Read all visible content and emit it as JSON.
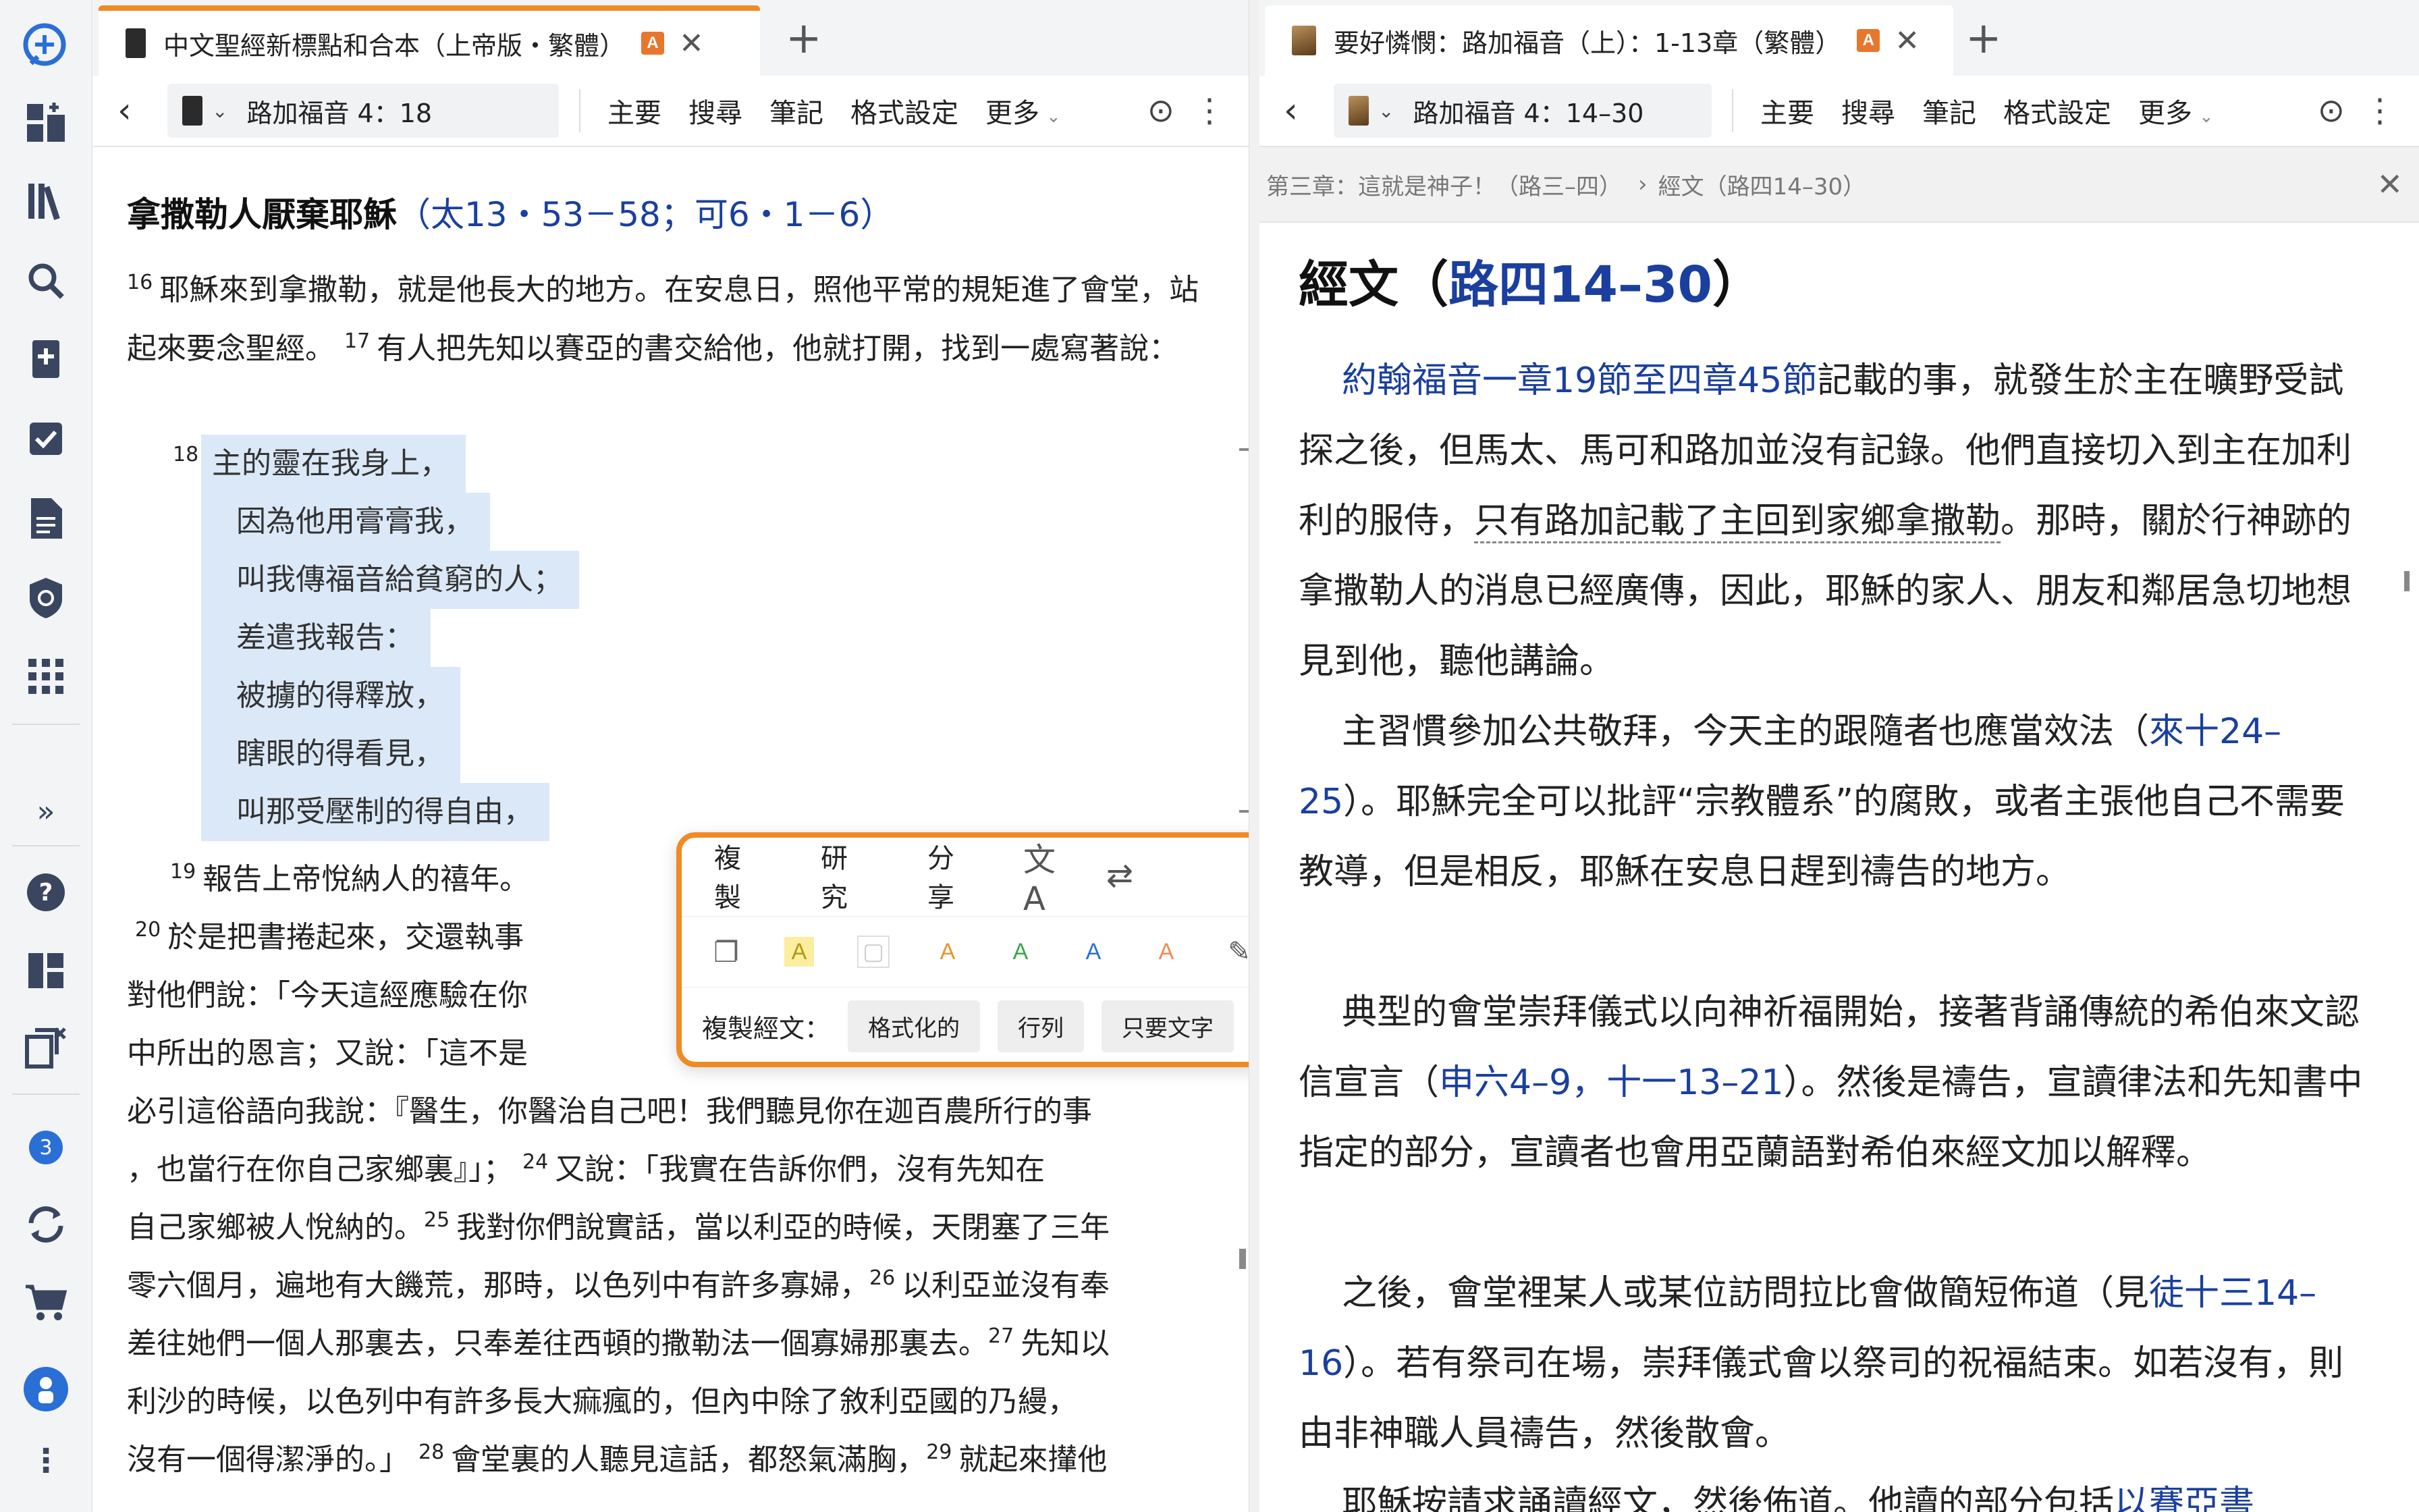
{
  "rail": {
    "items": [
      "logo-icon",
      "dashboard-add-icon",
      "library-icon",
      "search-icon",
      "bible-add-icon",
      "checklist-icon",
      "document-icon",
      "shield-icon",
      "apps-grid-icon"
    ],
    "expand": "»",
    "bottom": [
      "help-icon",
      "layout-icon",
      "copy-close-icon"
    ],
    "badge": "3",
    "bottom2": [
      "sync-icon",
      "cart-icon",
      "profile-icon",
      "more-icon"
    ]
  },
  "left": {
    "tab_title": "中文聖經新標點和合本（上帝版・繁體）",
    "tab_badge": "A",
    "ref": "路加福音 4：18",
    "toolbar": [
      "主要",
      "搜尋",
      "筆記",
      "格式設定",
      "更多"
    ],
    "heading": "拿撒勒人厭棄耶穌",
    "heading_refs_open": "（",
    "heading_ref1": "太13・53－58",
    "heading_sep": "；",
    "heading_ref2": "可6・1－6",
    "heading_refs_close": "）",
    "v16_num": "16",
    "v16": "耶穌來到拿撒勒，就是他長大的地方。在安息日，照他平常的規矩進了會堂，站起來要念聖經。",
    "v17_num": "17",
    "v17": "有人把先知以賽亞的書交給他，他就打開，找到一處寫著說：",
    "v18_num": "18",
    "poem": [
      "主的靈在我身上，",
      "因為他用膏膏我，",
      "叫我傳福音給貧窮的人；",
      "差遣我報告：",
      "被擄的得釋放，",
      "瞎眼的得看見，",
      "叫那受壓制的得自由，"
    ],
    "v19_num": "19",
    "v19": "報告上帝悅納人的禧年。",
    "v20_num": "20",
    "v20_a": "於是把書捲起來，交還執事",
    "line_a": "對他們說：「今天這經應驗在你",
    "line_b": "中所出的恩言；又說：「這不是",
    "line_c": "必引這俗語向我說：『醫生，你醫治自己吧！我們聽見你在迦百農所行的事",
    "line_d_a": "，也當行在你自己家鄉裏』」；",
    "v24_num": "24",
    "line_d_b": "又說：「我實在告訴你們，沒有先知在",
    "line_e_a": "自己家鄉被人悅納的。",
    "v25_num": "25",
    "line_e_b": "我對你們說實話，當以利亞的時候，天閉塞了三年",
    "line_f_a": "零六個月，遍地有大饑荒，那時，以色列中有許多寡婦，",
    "v26_num": "26",
    "line_f_b": "以利亞並沒有奉",
    "line_g_a": "差往她們一個人那裏去，只奉差往西頓的撒勒法一個寡婦那裏去。",
    "v27_num": "27",
    "line_g_b": "先知以",
    "line_h": "利沙的時候，以色列中有許多長大痲瘋的，但內中除了敘利亞國的乃縵，",
    "line_i_a": "沒有一個得潔淨的。」",
    "v28_num": "28",
    "line_i_b": "會堂裏的人聽見這話，都怒氣滿胸，",
    "v29_num": "29",
    "line_i_c": "就起來攆他"
  },
  "popup": {
    "row1": [
      "複製",
      "研究",
      "分享"
    ],
    "row1_icons": [
      "translate-icon",
      "swap-icon",
      "ellipsis-icon"
    ],
    "highlights": [
      "A",
      "",
      "A",
      "A",
      "A",
      "A"
    ],
    "highlight_colors": [
      "#b49a12",
      "#cfcfcf",
      "#e8962e",
      "#3aa54a",
      "#2a6fd6",
      "#f08a54"
    ],
    "copy_label": "複製經文：",
    "chips": [
      "格式化的",
      "行列",
      "只要文字"
    ]
  },
  "right": {
    "tab_title": "要好憐憫：路加福音（上）：1-13章（繁體）",
    "tab_badge": "A",
    "ref": "路加福音 4：14–30",
    "toolbar": [
      "主要",
      "搜尋",
      "筆記",
      "格式設定",
      "更多"
    ],
    "crumb1": "第三章：這就是神子！（路三–四）",
    "crumb_sep": "›",
    "crumb2": "經文（路四14–30）",
    "title_a": "經文（",
    "title_link": "路四14–30",
    "title_b": "）",
    "p1_link": "約翰福音一章19節至四章45節",
    "p1_a": "記載的事，就發生於主在曠野受試探之後，但馬太、馬可和路加並沒有記錄。他們直接切入到主在加利利的服侍，",
    "p1_dotted": "只有路加記載了主回到家鄉拿撒勒",
    "p1_b": "。那時，關於行神跡的拿撒勒人的消息已經廣傳，因此，耶穌的家人、朋友和鄰居急切地想見到他，聽他講論。",
    "p2_a": "主習慣參加公共敬拜，今天主的跟隨者也應當效法（",
    "p2_link": "來十24–25",
    "p2_b": "）。耶穌完全可以批評“宗教體系”的腐敗，或者主張他自己不需要教導，但是相反，耶穌在安息日趕到禱告的地方。",
    "p3_a": "典型的會堂崇拜儀式以向神祈福開始，接著背誦傳統的希伯來文認信宣言（",
    "p3_link1": "申六4–9",
    "p3_sep": "，",
    "p3_link2": "十一13–21",
    "p3_b": "）。然後是禱告，宣讀律法和先知書中指定的部分，宣讀者也會用亞蘭語對希伯來經文加以解釋。",
    "p4_a": "之後，會堂裡某人或某位訪問拉比會做簡短佈道（見",
    "p4_link": "徒十三14–16",
    "p4_b": "）。若有祭司在場，崇拜儀式會以祭司的祝福結束。如若沒有，則由非神職人員禱告，然後散會。",
    "p5_a": "耶穌按請求誦讀經文，然後佈道。他讀的部分包括",
    "p5_link": "以賽亞書"
  }
}
